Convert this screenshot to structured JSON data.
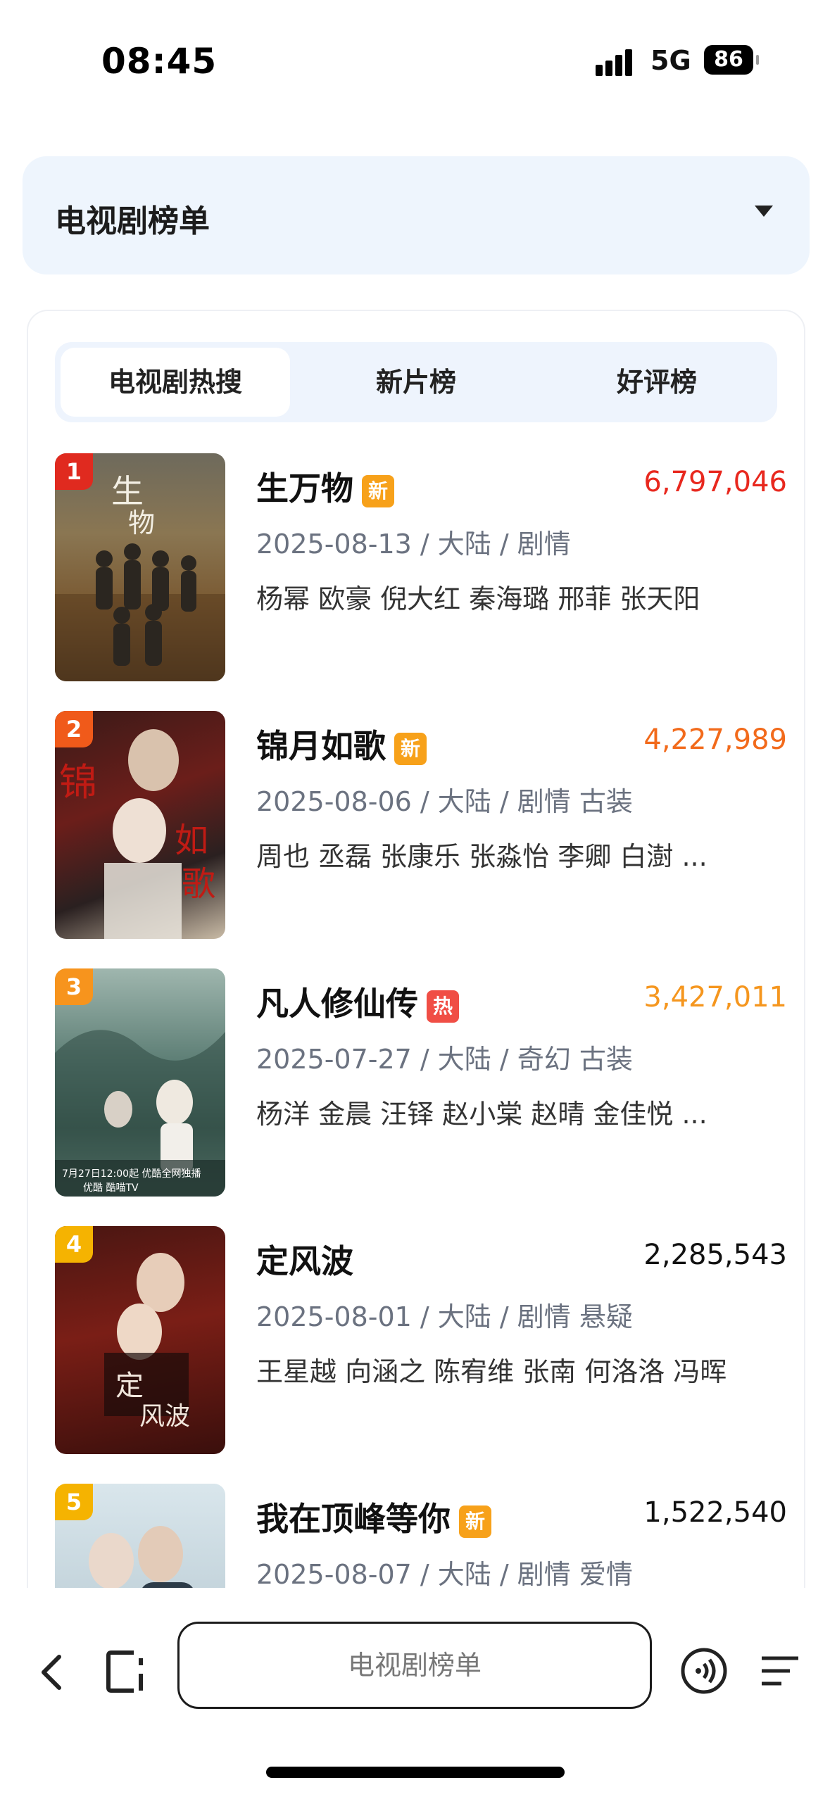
{
  "status_bar": {
    "time": "08:45",
    "network": "5G",
    "battery": "86"
  },
  "dropdown": {
    "title": "电视剧榜单"
  },
  "tabs": [
    {
      "label": "电视剧热搜",
      "active": true
    },
    {
      "label": "新片榜",
      "active": false
    },
    {
      "label": "好评榜",
      "active": false
    }
  ],
  "items": [
    {
      "rank": "1",
      "title": "生万物",
      "badge": "新",
      "hot": "6,797,046",
      "meta": "2025-08-13 / 大陆 / 剧情",
      "cast": "杨幂 欧豪 倪大红 秦海璐 邢菲 张天阳"
    },
    {
      "rank": "2",
      "title": "锦月如歌",
      "badge": "新",
      "hot": "4,227,989",
      "meta": "2025-08-06 / 大陆 / 剧情 古装",
      "cast": "周也 丞磊 张康乐 张淼怡 李卿 白澍 ..."
    },
    {
      "rank": "3",
      "title": "凡人修仙传",
      "badge": "热",
      "hot": "3,427,011",
      "meta": "2025-07-27 / 大陆 / 奇幻 古装",
      "cast": "杨洋 金晨 汪铎 赵小棠 赵晴 金佳悦 ..."
    },
    {
      "rank": "4",
      "title": "定风波",
      "badge": "",
      "hot": "2,285,543",
      "meta": "2025-08-01 / 大陆 / 剧情 悬疑",
      "cast": "王星越 向涵之 陈宥维 张南 何洛洛 冯晖"
    },
    {
      "rank": "5",
      "title": "我在顶峰等你",
      "badge": "新",
      "hot": "1,522,540",
      "meta": "2025-08-07 / 大陆 / 剧情 爱情",
      "cast": ""
    }
  ],
  "address_bar": {
    "text": "电视剧榜单"
  },
  "colors": {
    "rank1": "#e02a1f",
    "rank2": "#f05a1a",
    "rank3": "#f7941d",
    "rank4": "#f5b301",
    "badge_new": "#f7a11a",
    "badge_hot": "#f04e45",
    "hot1": "#e8281e",
    "hot2": "#f26a1b",
    "hot3": "#f5961e"
  }
}
